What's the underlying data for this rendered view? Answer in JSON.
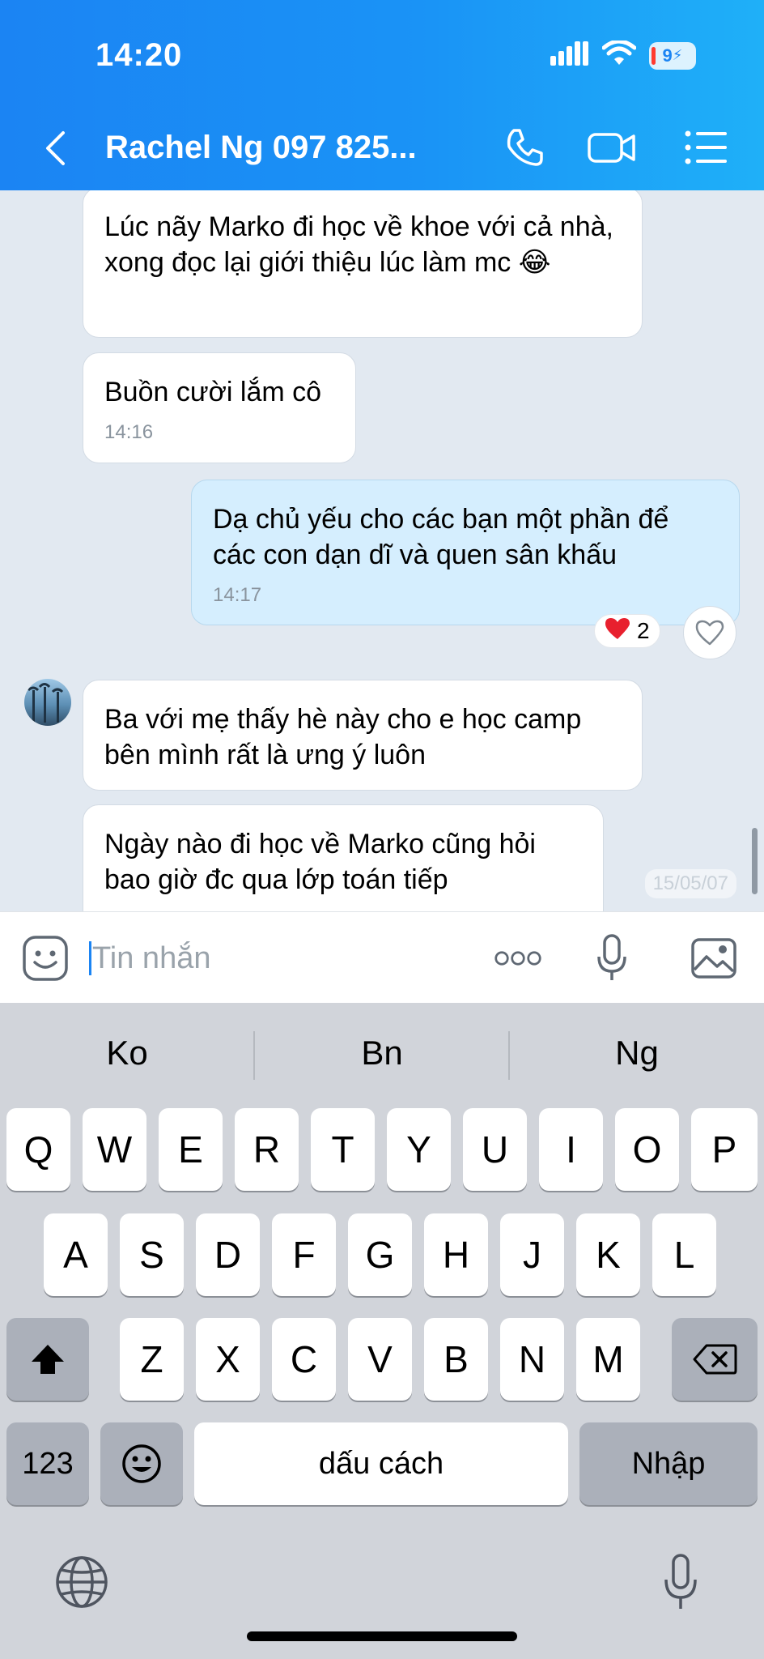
{
  "status_bar": {
    "time": "14:20",
    "battery": "9"
  },
  "header": {
    "contact_name": "Rachel Ng 097 825..."
  },
  "messages": [
    {
      "text": "Lúc nãy Marko đi học về khoe với cả nhà, xong đọc lại giới thiệu lúc làm mc",
      "emoji": "😂"
    },
    {
      "text": "Buồn cười lắm cô",
      "time": "14:16"
    },
    {
      "text": "Dạ chủ yếu cho các bạn một phần để các con dạn dĩ và quen sân khấu",
      "time": "14:17",
      "reaction_count": "2"
    },
    {
      "text": "Ba với mẹ thấy hè này cho e học camp bên mình rất là ưng ý luôn"
    },
    {
      "text": "Ngày nào đi học về Marko cũng hỏi bao giờ đc qua lớp toán tiếp"
    }
  ],
  "faint_date": "15/05/07",
  "input": {
    "placeholder": "Tin nhắn"
  },
  "keyboard": {
    "suggestions": [
      "Ko",
      "Bn",
      "Ng"
    ],
    "row1": [
      "Q",
      "W",
      "E",
      "R",
      "T",
      "Y",
      "U",
      "I",
      "O",
      "P"
    ],
    "row2": [
      "A",
      "S",
      "D",
      "F",
      "G",
      "H",
      "J",
      "K",
      "L"
    ],
    "row3": [
      "Z",
      "X",
      "C",
      "V",
      "B",
      "N",
      "M"
    ],
    "numbers_label": "123",
    "space_label": "dấu cách",
    "return_label": "Nhập"
  },
  "colors": {
    "header_gradient_start": "#1b84f3",
    "header_gradient_end": "#1fb0f8",
    "my_bubble": "#d5eefe",
    "chat_bg": "#e2e9f1"
  }
}
